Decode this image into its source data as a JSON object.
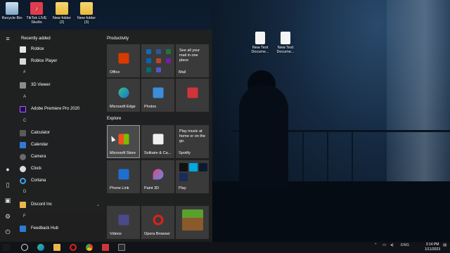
{
  "desktop": {
    "icons": [
      {
        "label": "Recycle Bin",
        "icon": "recycle-bin-icon"
      },
      {
        "label": "TikTok LIVE Studio",
        "icon": "tiktok-icon"
      },
      {
        "label": "New folder (2)",
        "icon": "folder-icon"
      },
      {
        "label": "New folder (3)",
        "icon": "folder-icon"
      },
      {
        "label": "New Text Docume...",
        "icon": "text-document-icon"
      },
      {
        "label": "New Text Docume...",
        "icon": "text-document-icon"
      }
    ]
  },
  "start_menu": {
    "recently_added_label": "Recently added",
    "recent_apps": [
      "Roblox",
      "Roblox Player"
    ],
    "sections": [
      {
        "letter": "#",
        "apps": [
          "3D Viewer"
        ]
      },
      {
        "letter": "A",
        "apps": [
          "Adobe Premiere Pro 2020"
        ]
      },
      {
        "letter": "C",
        "apps": [
          "Calculator",
          "Calendar",
          "Camera",
          "Clock",
          "Cortana"
        ]
      },
      {
        "letter": "D",
        "apps": [
          "Discord Inc"
        ]
      },
      {
        "letter": "F",
        "apps": [
          "Feedback Hub"
        ]
      }
    ],
    "groups": {
      "productivity": "Productivity",
      "explore": "Explore"
    },
    "tiles": {
      "office": "Office",
      "mail_promo": "See all your mail in one place",
      "mail": "Mail",
      "edge": "Microsoft Edge",
      "photos": "Photos",
      "store": "Microsoft Store",
      "solitaire": "Solitaire & Ca...",
      "spotify_promo": "Play music at home or on the go.",
      "spotify": "Spotify",
      "phone_link": "Phone Link",
      "paint3d": "Paint 3D",
      "play": "Play",
      "videos": "Videos",
      "opera": "Opera Browser"
    }
  },
  "taskbar": {
    "lang": "ENG",
    "time": "3:14 PM",
    "date": "1/11/2023"
  },
  "colors": {
    "start_bg": "#202020",
    "tile_bg": "#3a3a3a",
    "taskbar_bg": "#101418"
  }
}
